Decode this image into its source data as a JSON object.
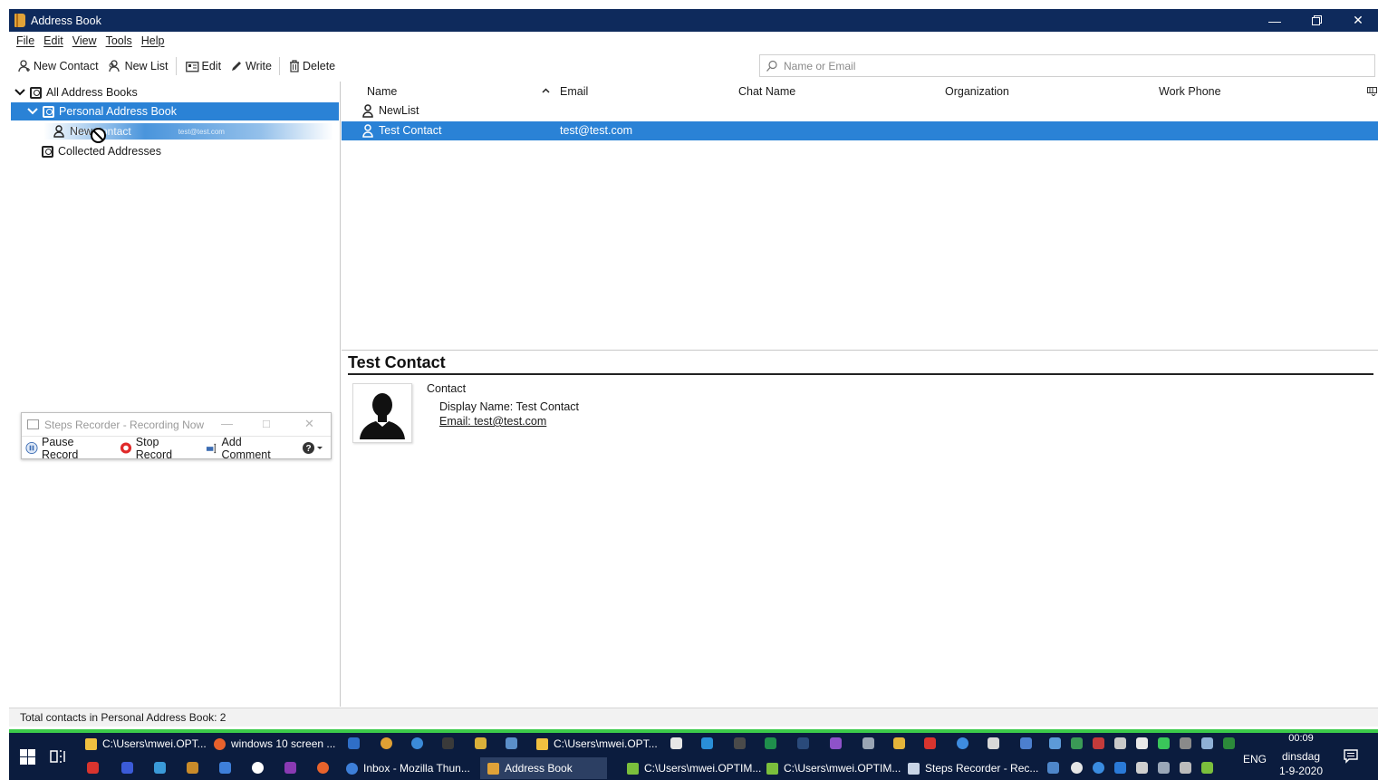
{
  "window": {
    "title": "Address Book"
  },
  "menu": [
    "File",
    "Edit",
    "View",
    "Tools",
    "Help"
  ],
  "toolbar": {
    "new_contact": "New Contact",
    "new_list": "New List",
    "edit": "Edit",
    "write": "Write",
    "delete": "Delete",
    "search_placeholder": "Name or Email"
  },
  "tree": {
    "all": "All Address Books",
    "personal": "Personal Address Book",
    "newlist_child": "New",
    "collected": "Collected Addresses"
  },
  "drag_ghost": {
    "name": "Test Contact",
    "email": "test@test.com"
  },
  "columns": {
    "name": "Name",
    "email": "Email",
    "chat": "Chat Name",
    "org": "Organization",
    "phone": "Work Phone"
  },
  "rows": [
    {
      "name": "NewList",
      "email": ""
    },
    {
      "name": "Test Contact",
      "email": "test@test.com"
    }
  ],
  "card": {
    "title": "Test Contact",
    "section": "Contact",
    "display_name": "Display Name: Test Contact",
    "email": "Email: test@test.com"
  },
  "status": "Total contacts in Personal Address Book: 2",
  "steps_recorder": {
    "title": "Steps Recorder - Recording Now",
    "pause": "Pause Record",
    "stop": "Stop Record",
    "comment": "Add Comment"
  },
  "taskbar": {
    "row1": [
      "C:\\Users\\mwei.OPT...",
      "windows 10 screen ...",
      "C:\\Users\\mwei.OPT..."
    ],
    "row2": [
      "Inbox - Mozilla Thun...",
      "Address Book",
      "C:\\Users\\mwei.OPTIM...",
      "C:\\Users\\mwei.OPTIM...",
      "Steps Recorder - Rec..."
    ],
    "lang": "ENG",
    "time": "00:09",
    "day": "dinsdag",
    "date": "1-9-2020"
  },
  "colors": {
    "titlebar": "#0e2a5c",
    "selection": "#2a82d6",
    "taskbar": "#0b1c3e",
    "taskbar_accent": "#3ccb4a"
  }
}
